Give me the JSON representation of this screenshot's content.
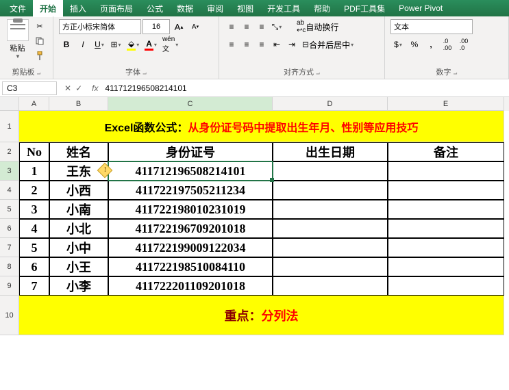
{
  "tabs": [
    "文件",
    "开始",
    "插入",
    "页面布局",
    "公式",
    "数据",
    "审阅",
    "视图",
    "开发工具",
    "帮助",
    "PDF工具集",
    "Power Pivot"
  ],
  "activeTab": 1,
  "ribbon": {
    "paste": "粘贴",
    "clipboard": "剪贴板",
    "fontName": "方正小标宋简体",
    "fontSize": "16",
    "font": "字体",
    "wrap": "自动换行",
    "merge": "合并后居中",
    "align": "对齐方式",
    "numFormat": "文本",
    "number": "数字"
  },
  "cellRef": "C3",
  "formula": "411712196508214101",
  "cols": [
    "A",
    "B",
    "C",
    "D",
    "E"
  ],
  "title": {
    "prefix": "Excel函数公式：",
    "rest": "从身份证号码中提取出生年月、性别等应用技巧"
  },
  "headers": {
    "no": "No",
    "name": "姓名",
    "id": "身份证号",
    "birth": "出生日期",
    "note": "备注"
  },
  "rows": [
    {
      "no": "1",
      "name": "王东",
      "id": "411712196508214101"
    },
    {
      "no": "2",
      "name": "小西",
      "id": "411722197505211234"
    },
    {
      "no": "3",
      "name": "小南",
      "id": "411722198010231019"
    },
    {
      "no": "4",
      "name": "小北",
      "id": "411722196709201018"
    },
    {
      "no": "5",
      "name": "小中",
      "id": "411722199009122034"
    },
    {
      "no": "6",
      "name": "小王",
      "id": "411722198510084110"
    },
    {
      "no": "7",
      "name": "小李",
      "id": "411722201109201018"
    }
  ],
  "footer": {
    "label": "重点：",
    "value": "分列法"
  },
  "selectedIdDisplay": "411712196508214101"
}
